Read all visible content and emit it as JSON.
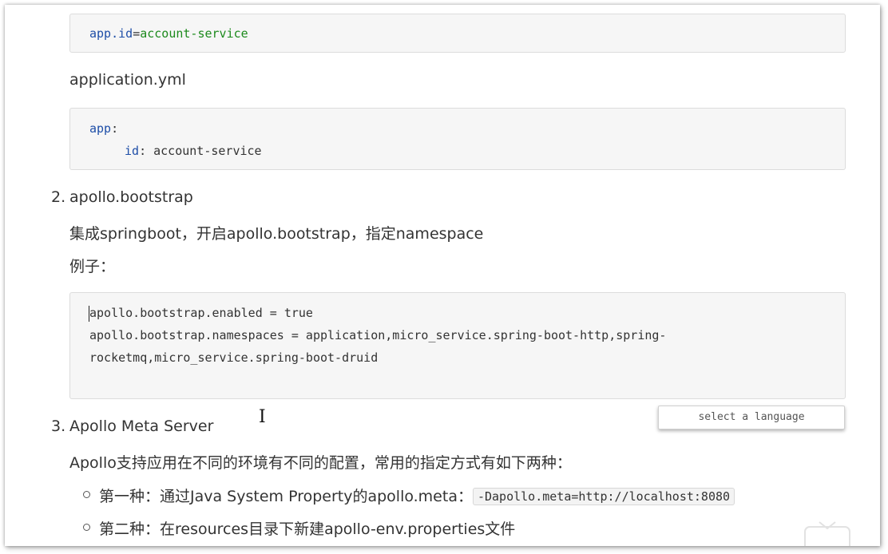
{
  "block1": {
    "key": "app.id",
    "eq": "=",
    "value": "account-service"
  },
  "application_yml_label": "application.yml",
  "block2": {
    "line1_key": "app",
    "line1_colon": ":",
    "line2_key": "id",
    "line2_rest": ": account-service"
  },
  "section2": {
    "number": "2.",
    "title": "apollo.bootstrap",
    "desc": "集成springboot，开启apollo.bootstrap，指定namespace",
    "example_label": "例子："
  },
  "block3": {
    "line1": "apollo.bootstrap.enabled = true",
    "line2": "apollo.bootstrap.namespaces = application,micro_service.spring-boot-http,spring-",
    "line3": "rocketmq,micro_service.spring-boot-druid"
  },
  "lang_select_label": "select a language",
  "section3": {
    "number": "3.",
    "title": "Apollo Meta Server",
    "desc": "Apollo支持应用在不同的环境有不同的配置，常用的指定方式有如下两种：",
    "item1_text": "第一种：通过Java System Property的apollo.meta：",
    "item1_code": "-Dapollo.meta=http://localhost:8080",
    "item2_text": "第二种：在resources目录下新建apollo-env.properties文件"
  },
  "colors": {
    "keyword": "#1f4fa8",
    "string": "#1c8a1c",
    "code_bg": "#f6f6f6"
  }
}
